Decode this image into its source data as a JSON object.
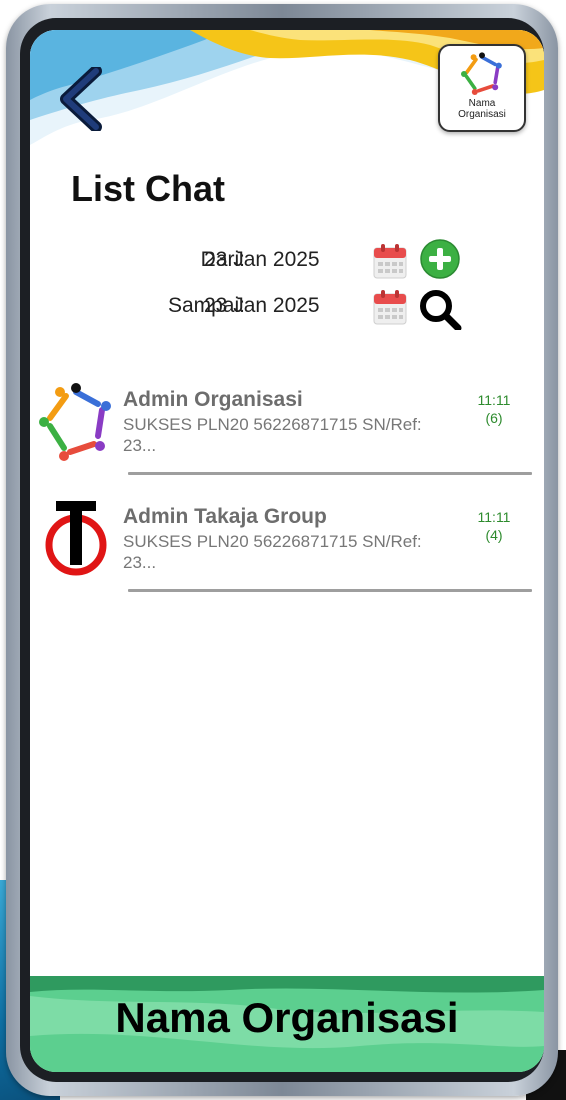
{
  "header": {
    "back_icon": "chevron-left-icon",
    "org_badge_label": "Nama Organisasi"
  },
  "page": {
    "title": "List Chat"
  },
  "filters": {
    "from_label": "Dari:",
    "from_value": "23 Jan 2025",
    "to_label": "Sampai:",
    "to_value": "23 Jan 2025",
    "calendar_icon": "calendar-icon",
    "add_icon": "plus-circle-icon",
    "search_icon": "search-icon"
  },
  "chats": [
    {
      "name": "Admin  Organisasi",
      "message": "SUKSES PLN20 56226871715 SN/Ref: 23...",
      "time": "11:11",
      "count": "(6)",
      "avatar": "organization-logo"
    },
    {
      "name": "Admin Takaja Group",
      "message": "SUKSES PLN20 56226871715 SN/Ref: 23...",
      "time": "11:11",
      "count": "(4)",
      "avatar": "takaja-logo"
    }
  ],
  "footer": {
    "title": "Nama Organisasi"
  },
  "colors": {
    "accent_green": "#2e8b2e",
    "header_yellow": "#f5c518",
    "header_blue": "#5ab4e0",
    "footer_green": "#5ccf8f",
    "calendar_red": "#e84c4c",
    "add_green": "#3cb043"
  }
}
